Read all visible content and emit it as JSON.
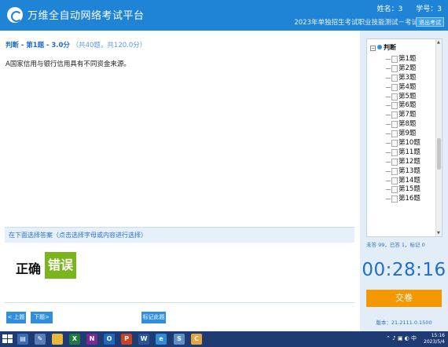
{
  "header": {
    "app_title": "万维全自动网络考试平台",
    "seat_label": "姓名：3",
    "student_id_label": "学号：3",
    "exam_name": "2023年单独招生考试职业技能测试－考试",
    "exit_button": "退出考试",
    "logo_icon": "logo-swirl-icon"
  },
  "question": {
    "type_label": "判断",
    "number_label": "第1题",
    "score_label": "3.0分",
    "meta": "（共40题，共120.0分）",
    "text": "A国家信用与银行信用具有不同资金来源。"
  },
  "answer": {
    "hint": "在下面选择答案（点击选择字母或内容进行选择）",
    "options": [
      "正确",
      "错误"
    ],
    "selected": "错误",
    "selected_color": "#7ab51d"
  },
  "nav": {
    "prev": "< 上题",
    "next": "下题>",
    "mark": "标记此题"
  },
  "tree": {
    "root_label": "判断",
    "items": [
      "第1题",
      "第2题",
      "第3题",
      "第4题",
      "第5题",
      "第6题",
      "第7题",
      "第8题",
      "第9题",
      "第10题",
      "第11题",
      "第12题",
      "第13题",
      "第14题",
      "第15题",
      "第16题"
    ],
    "status": "未答 99，已答 1，标记 0"
  },
  "timer": "00:28:16",
  "submit_label": "交卷",
  "version": "版本：21.2111.0.1500",
  "taskbar": {
    "icons": [
      "start-icon",
      "file-explorer-icon",
      "notes-icon",
      "folder-icon",
      "excel-icon",
      "onenote-icon",
      "outlook-icon",
      "powerpoint-icon",
      "word-icon",
      "ie-icon",
      "s-app-icon",
      "yellow-app-icon"
    ],
    "clock_time": "15:16",
    "clock_date": "2023/5/4"
  },
  "colors": {
    "header": "#1f83d6",
    "accent": "#2f8ee0",
    "submit": "#f39800",
    "taskbar": "#1f3b73"
  }
}
